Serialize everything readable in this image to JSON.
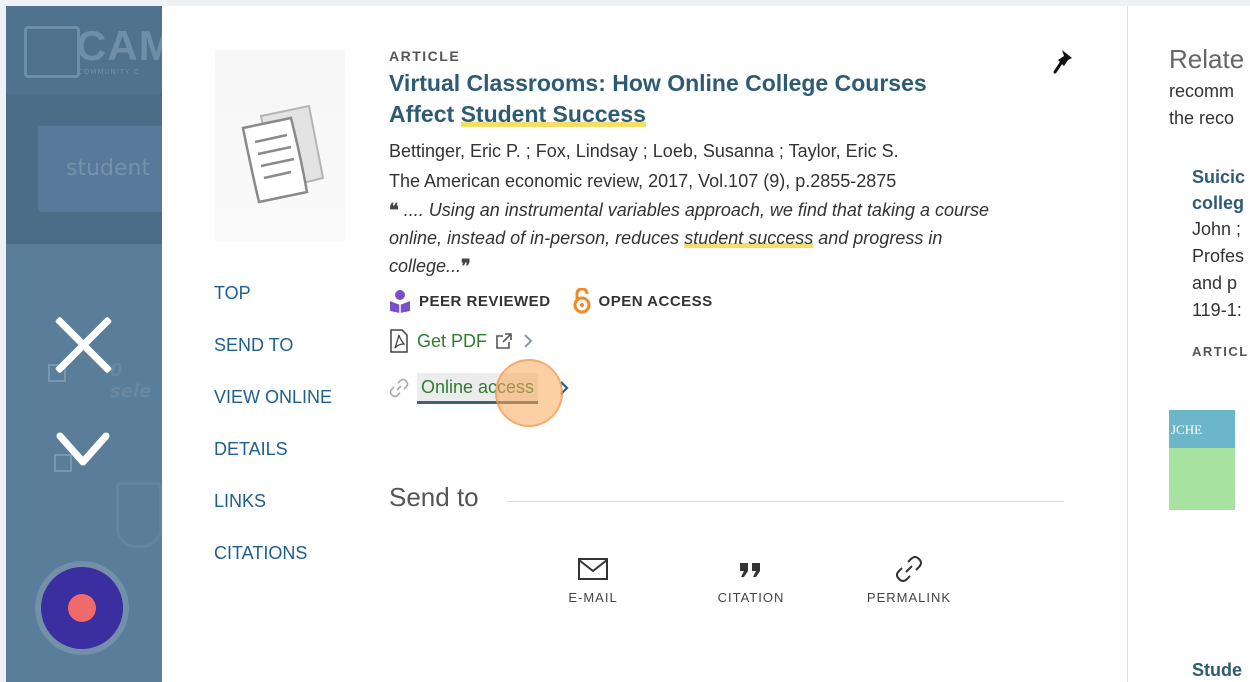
{
  "background": {
    "logo_text": "CAM",
    "logo_sub": "COMMUNITY C",
    "search_text": "student",
    "selected_text": "0 sele"
  },
  "item": {
    "type": "ARTICLE",
    "title_part1": "Virtual Classrooms: How Online College Courses Affect ",
    "title_highlight": "Student Success",
    "authors": "Bettinger, Eric P. ; Fox, Lindsay ; Loeb, Susanna ; Taylor, Eric S.",
    "source": "The American economic review, 2017, Vol.107 (9), p.2855-2875",
    "snippet_part1": " .... Using an instrumental variables approach, we find that taking a course online, instead of in-person, reduces ",
    "snippet_highlight": "student success",
    "snippet_part2": " and progress in college...",
    "quote_open": "❝",
    "quote_close": "❞",
    "badge_peer": "PEER REVIEWED",
    "badge_open": "OPEN ACCESS",
    "get_pdf": "Get PDF",
    "online_access": "Online access"
  },
  "nav": [
    "TOP",
    "SEND TO",
    "VIEW ONLINE",
    "DETAILS",
    "LINKS",
    "CITATIONS"
  ],
  "send_to": {
    "heading": "Send to",
    "actions": [
      "E-MAIL",
      "CITATION",
      "PERMALINK"
    ]
  },
  "related": {
    "title": "Relate",
    "desc_line1": "recomm",
    "desc_line2": "the reco",
    "item1_line1": "Suicic",
    "item1_line2": "colleg",
    "meta_line1": "John ;",
    "meta_line2": "Profes",
    "meta_line3": "and p",
    "meta_line4": "119-1:",
    "item1_type": "ARTICL",
    "cover_text": "JCHE",
    "item2_line1": "Stude"
  },
  "colors": {
    "title": "#2e5b74",
    "link_green": "#2e7d32",
    "nav_blue": "#1f5f8b",
    "highlight": "#f4de6a",
    "peer_purple": "#7b4fc9",
    "open_orange": "#f08a24",
    "record_button": "#3a2ea0"
  }
}
